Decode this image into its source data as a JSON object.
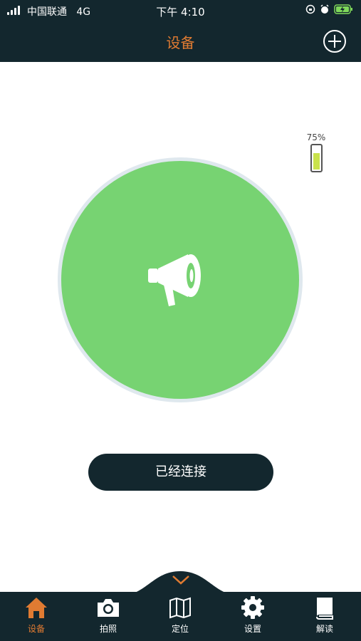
{
  "status_bar": {
    "carrier": "中国联通",
    "network": "4G",
    "time": "下午 4:10",
    "battery_icon": "battery-charging-icon"
  },
  "nav": {
    "title": "设备",
    "add_icon": "plus-circle-icon"
  },
  "battery": {
    "label": "75%",
    "level": 0.75,
    "color": "#c9e24b"
  },
  "device": {
    "icon": "megaphone-icon",
    "color": "#77d372"
  },
  "connect_button": "已经连接",
  "tabs": [
    {
      "label": "设备",
      "icon": "home-icon",
      "active": true
    },
    {
      "label": "拍照",
      "icon": "camera-icon",
      "active": false
    },
    {
      "label": "定位",
      "icon": "map-icon",
      "active": false
    },
    {
      "label": "设置",
      "icon": "gear-icon",
      "active": false
    },
    {
      "label": "解读",
      "icon": "book-icon",
      "active": false
    }
  ],
  "colors": {
    "dark": "#13272e",
    "accent": "#e07b32"
  }
}
